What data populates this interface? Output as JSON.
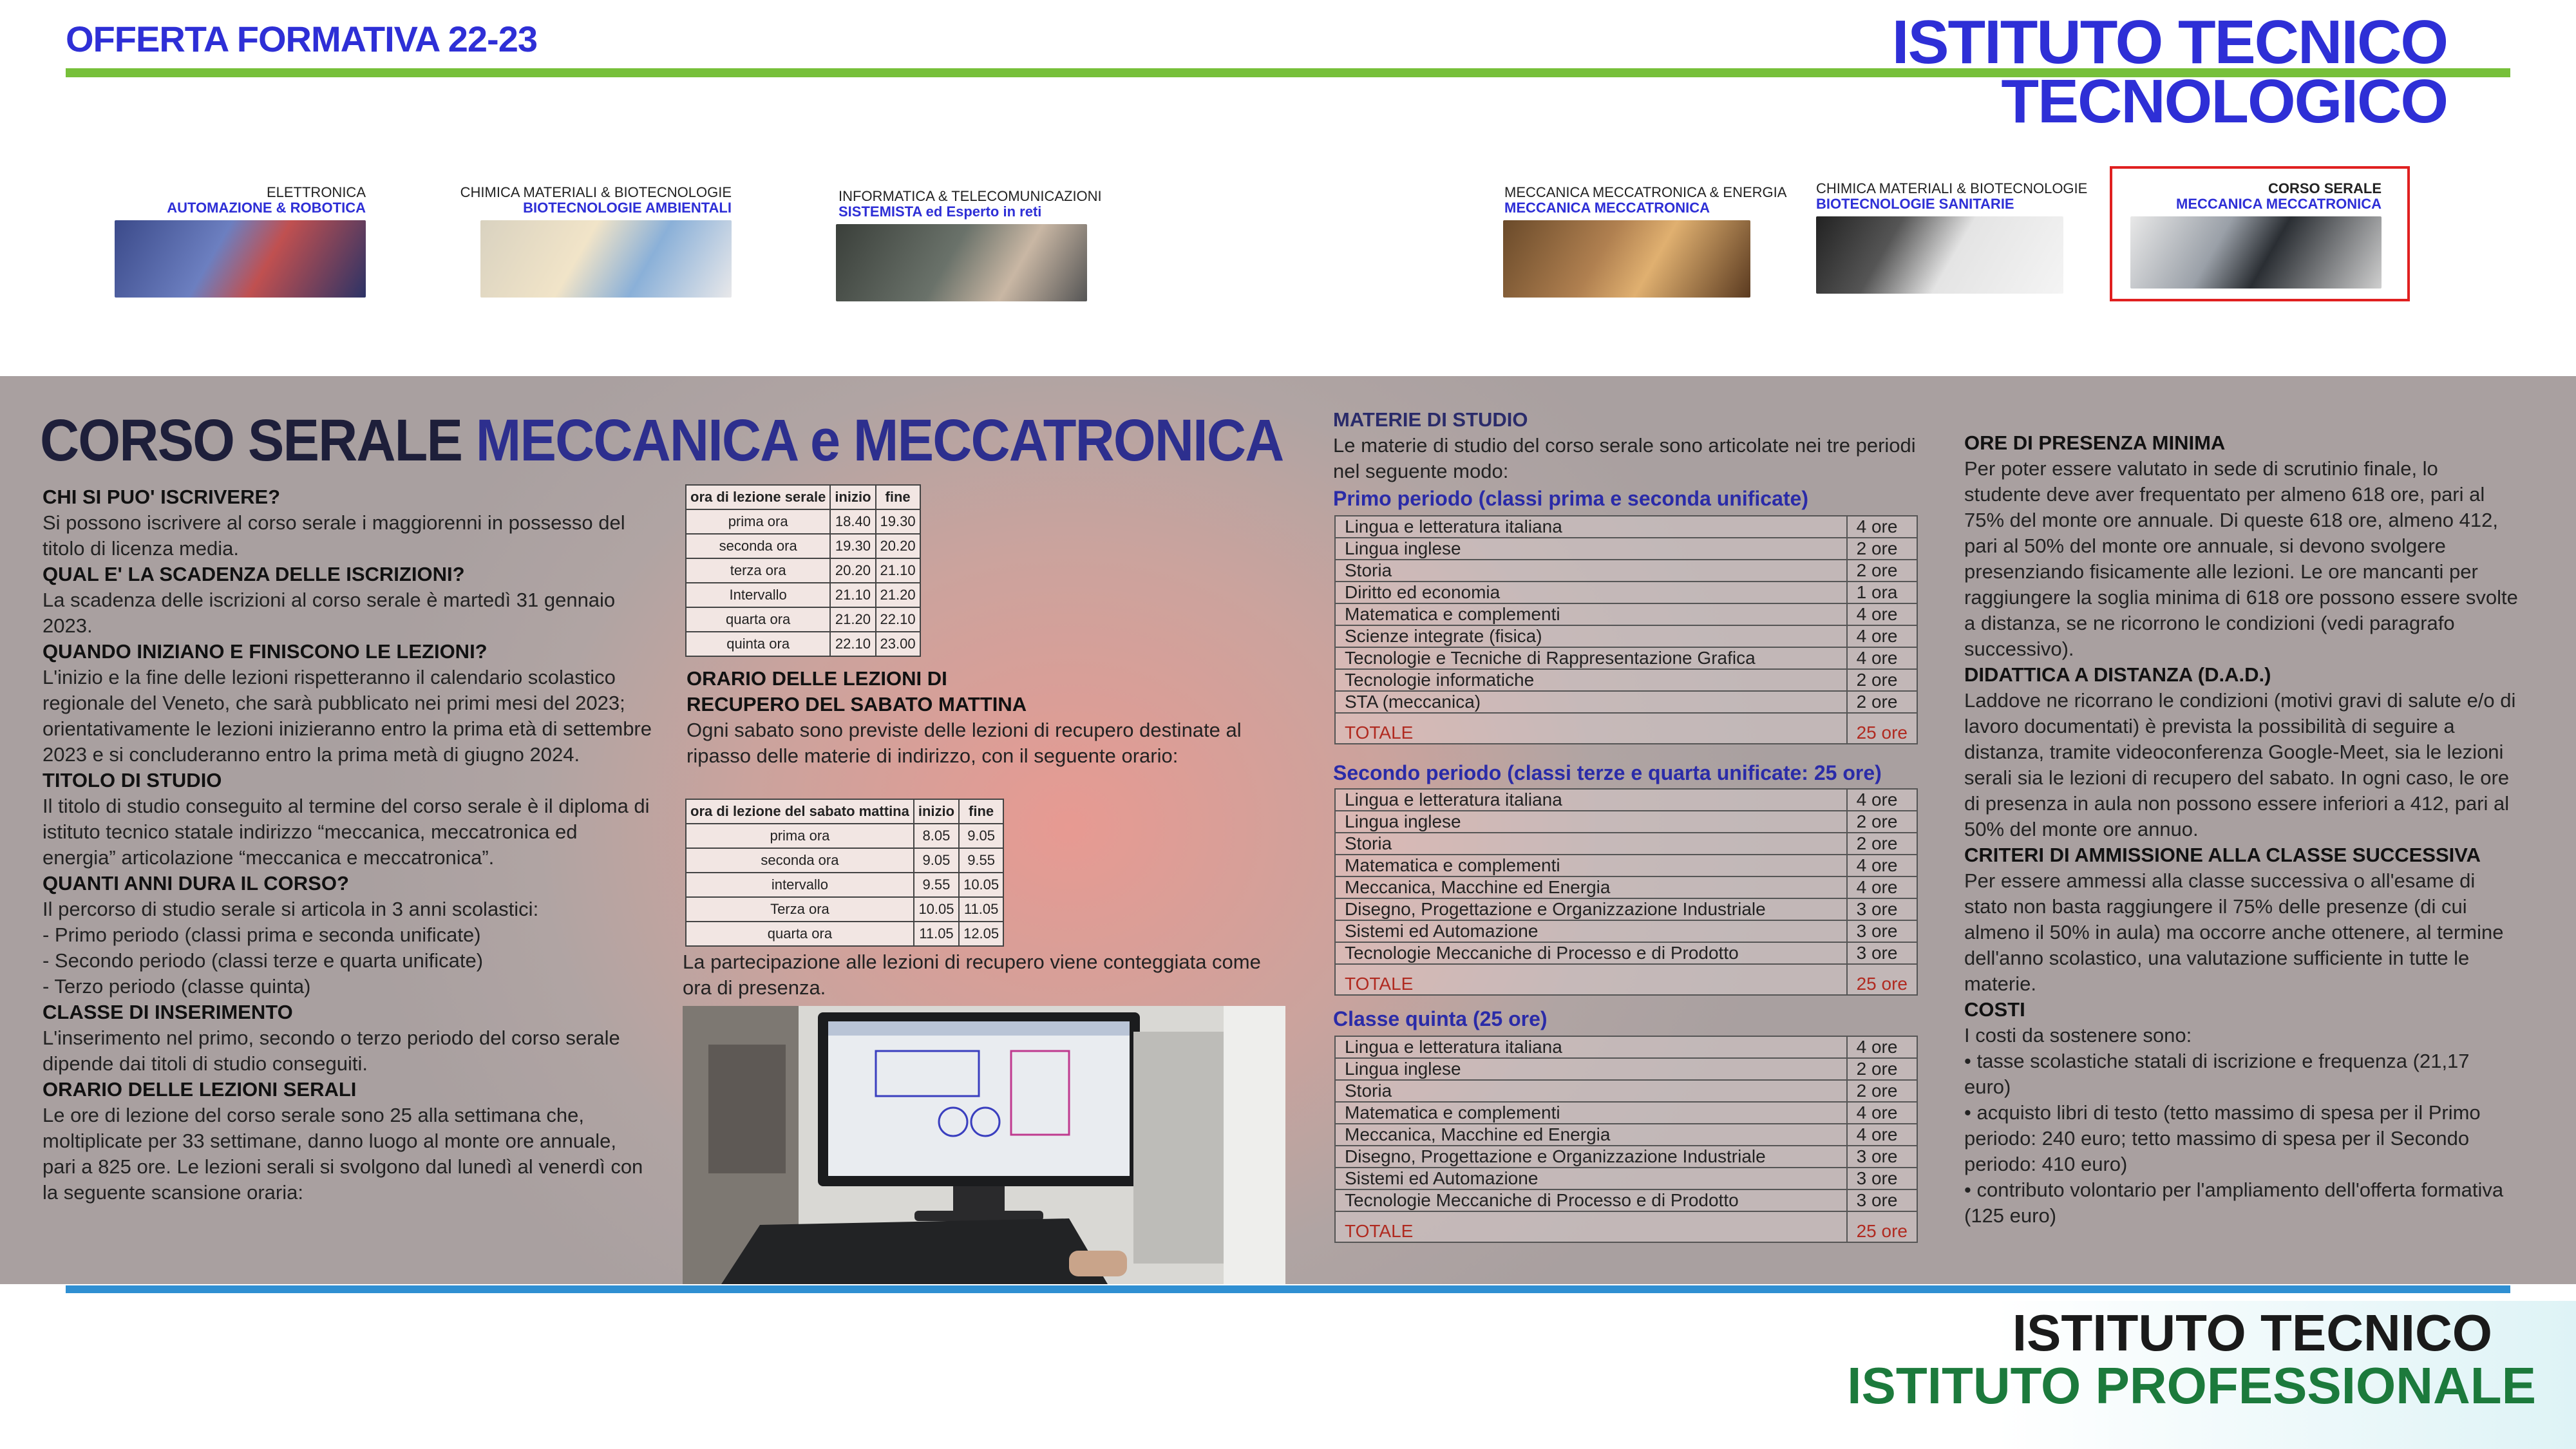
{
  "header": {
    "left_title": "OFFERTA FORMATIVA 22-23",
    "right_title_line1": "ISTITUTO TECNICO",
    "right_title_line2": "TECNOLOGICO"
  },
  "courses": [
    {
      "line1": "ELETTRONICA",
      "line2": "AUTOMAZIONE & ROBOTICA"
    },
    {
      "line1": "CHIMICA MATERIALI & BIOTECNOLOGIE",
      "line2": "BIOTECNOLOGIE AMBIENTALI"
    },
    {
      "line1": "INFORMATICA & TELECOMUNICAZIONI",
      "line2": "SISTEMISTA ed Esperto in reti"
    },
    {
      "line1": "MECCANICA MECCATRONICA & ENERGIA",
      "line2": "MECCANICA MECCATRONICA"
    },
    {
      "line1": "CHIMICA MATERIALI & BIOTECNOLOGIE",
      "line2": "BIOTECNOLOGIE SANITARIE"
    },
    {
      "line1": "CORSO SERALE",
      "line2": "MECCANICA MECCATRONICA"
    }
  ],
  "main_title": {
    "part1": "CORSO SERALE ",
    "part2": "MECCANICA e MECCATRONICA"
  },
  "col1": {
    "q1": "CHI SI PUO' ISCRIVERE?",
    "a1": "Si possono iscrivere al corso serale i maggiorenni in possesso del titolo di licenza media.",
    "q2": "QUAL E' LA SCADENZA DELLE ISCRIZIONI?",
    "a2": "La scadenza delle iscrizioni al corso serale è martedì 31 gennaio 2023.",
    "q3": "QUANDO INIZIANO E FINISCONO LE LEZIONI?",
    "a3": "L'inizio e la fine delle lezioni rispetteranno il calendario scolastico regionale del Veneto, che sarà pubblicato nei primi mesi del 2023; orientativamente le lezioni inizieranno entro la prima età di settembre 2023 e si concluderanno entro la prima metà di giugno 2024.",
    "q4": "TITOLO DI STUDIO",
    "a4": "Il titolo di studio conseguito al termine del corso serale è il diploma di istituto tecnico statale indirizzo “meccanica, meccatronica ed energia” articolazione “meccanica e meccatronica”.",
    "q5": "QUANTI ANNI DURA IL CORSO?",
    "a5": "Il percorso di studio serale si articola in 3 anni scolastici:",
    "a5_l1": "- Primo periodo (classi prima e seconda unificate)",
    "a5_l2": "- Secondo periodo (classi terze e quarta unificate)",
    "a5_l3": "- Terzo periodo (classe quinta)",
    "q6": "CLASSE DI INSERIMENTO",
    "a6": "L'inserimento nel primo, secondo o terzo periodo del corso serale dipende dai titoli di studio conseguiti.",
    "q7": "ORARIO DELLE LEZIONI SERALI",
    "a7": "Le ore di lezione del corso serale sono 25 alla settimana che, moltiplicate per 33 settimane, danno luogo al monte ore annuale, pari a 825 ore. Le lezioni serali si svolgono dal lunedì al venerdì con la seguente scansione oraria:"
  },
  "evening_table": {
    "headers": [
      "ora di lezione serale",
      "inizio",
      "fine"
    ],
    "rows": [
      [
        "prima ora",
        "18.40",
        "19.30"
      ],
      [
        "seconda ora",
        "19.30",
        "20.20"
      ],
      [
        "terza ora",
        "20.20",
        "21.10"
      ],
      [
        "Intervallo",
        "21.10",
        "21.20"
      ],
      [
        "quarta ora",
        "21.20",
        "22.10"
      ],
      [
        "quinta ora",
        "22.10",
        "23.00"
      ]
    ]
  },
  "saturday": {
    "title_l1": "ORARIO DELLE LEZIONI DI",
    "title_l2": "RECUPERO DEL SABATO MATTINA",
    "text": "Ogni sabato sono previste delle lezioni di recupero destinate al ripasso delle materie di indirizzo, con il seguente orario:",
    "headers": [
      "ora di lezione del sabato mattina",
      "inizio",
      "fine"
    ],
    "rows": [
      [
        "prima ora",
        "8.05",
        "9.05"
      ],
      [
        "seconda ora",
        "9.05",
        "9.55"
      ],
      [
        "intervallo",
        "9.55",
        "10.05"
      ],
      [
        "Terza ora",
        "10.05",
        "11.05"
      ],
      [
        "quarta ora",
        "11.05",
        "12.05"
      ]
    ],
    "note": "La partecipazione alle lezioni di recupero viene conteggiata come ora di presenza."
  },
  "subjects": {
    "title": "MATERIE DI STUDIO",
    "intro": "Le materie di studio del corso serale sono articolate nei tre periodi nel seguente modo:",
    "periods": [
      {
        "title": "Primo periodo (classi prima e seconda unificate)",
        "rows": [
          [
            "Lingua e letteratura italiana",
            "4 ore"
          ],
          [
            "Lingua inglese",
            "2 ore"
          ],
          [
            "Storia",
            "2 ore"
          ],
          [
            "Diritto ed economia",
            "1 ora"
          ],
          [
            "Matematica e complementi",
            "4 ore"
          ],
          [
            "Scienze integrate (fisica)",
            "4 ore"
          ],
          [
            "Tecnologie e Tecniche di Rappresentazione Grafica",
            "4 ore"
          ],
          [
            "Tecnologie informatiche",
            "2 ore"
          ],
          [
            "STA (meccanica)",
            "2 ore"
          ]
        ],
        "total": [
          "TOTALE",
          "25 ore"
        ]
      },
      {
        "title": "Secondo periodo (classi terze e quarta unificate: 25 ore)",
        "rows": [
          [
            "Lingua e letteratura italiana",
            "4 ore"
          ],
          [
            "Lingua inglese",
            "2 ore"
          ],
          [
            "Storia",
            "2 ore"
          ],
          [
            "Matematica e complementi",
            "4 ore"
          ],
          [
            "Meccanica, Macchine ed Energia",
            "4 ore"
          ],
          [
            "Disegno, Progettazione e Organizzazione Industriale",
            "3 ore"
          ],
          [
            "Sistemi ed Automazione",
            "3 ore"
          ],
          [
            "Tecnologie Meccaniche di Processo e di Prodotto",
            "3 ore"
          ]
        ],
        "total": [
          "TOTALE",
          "25 ore"
        ]
      },
      {
        "title": "Classe quinta (25 ore)",
        "rows": [
          [
            "Lingua e letteratura italiana",
            "4 ore"
          ],
          [
            "Lingua inglese",
            "2 ore"
          ],
          [
            "Storia",
            "2 ore"
          ],
          [
            "Matematica e complementi",
            "4 ore"
          ],
          [
            "Meccanica, Macchine ed Energia",
            "4 ore"
          ],
          [
            "Disegno, Progettazione e Organizzazione Industriale",
            "3 ore"
          ],
          [
            "Sistemi ed Automazione",
            "3 ore"
          ],
          [
            "Tecnologie Meccaniche di Processo e di Prodotto",
            "3 ore"
          ]
        ],
        "total": [
          "TOTALE",
          "25 ore"
        ]
      }
    ]
  },
  "col4": {
    "q1": "ORE DI PRESENZA MINIMA",
    "a1": "Per poter essere valutato in sede di scrutinio finale, lo studente deve aver frequentato per almeno 618 ore, pari al 75% del monte ore annuale. Di queste 618 ore, almeno 412, pari al 50% del monte ore annuale, si devono svolgere presenziando fisicamente alle lezioni. Le ore mancanti per raggiungere la soglia minima di 618 ore possono essere svolte a distanza, se ne ricorrono le condizioni (vedi paragrafo successivo).",
    "q2": "DIDATTICA A DISTANZA (D.A.D.)",
    "a2": "Laddove ne ricorrano le condizioni (motivi gravi di salute e/o di lavoro documentati) è prevista la possibilità di seguire a distanza, tramite videoconferenza Google-Meet, sia le lezioni serali sia le lezioni di recupero del sabato. In ogni caso, le ore di presenza in aula non possono essere inferiori a 412, pari al 50% del monte ore annuo.",
    "q3": "CRITERI DI AMMISSIONE ALLA CLASSE SUCCESSIVA",
    "a3": "Per essere ammessi alla classe successiva o all'esame di stato non basta raggiungere il 75% delle presenze (di cui almeno il 50% in aula) ma occorre anche ottenere, al termine dell'anno scolastico, una valutazione sufficiente in tutte le materie.",
    "q4": "COSTI",
    "a4": "I costi da sostenere sono:",
    "c1": "• tasse scolastiche statali di iscrizione e frequenza (21,17 euro)",
    "c2": "• acquisto libri di testo (tetto massimo di spesa per il Primo periodo: 240 euro; tetto massimo di spesa per il Secondo periodo: 410 euro)",
    "c3": "• contributo volontario per l'ampliamento dell'offerta formativa (125 euro)"
  },
  "footer": {
    "line1": "ISTITUTO TECNICO",
    "line2": "ISTITUTO PROFESSIONALE"
  }
}
